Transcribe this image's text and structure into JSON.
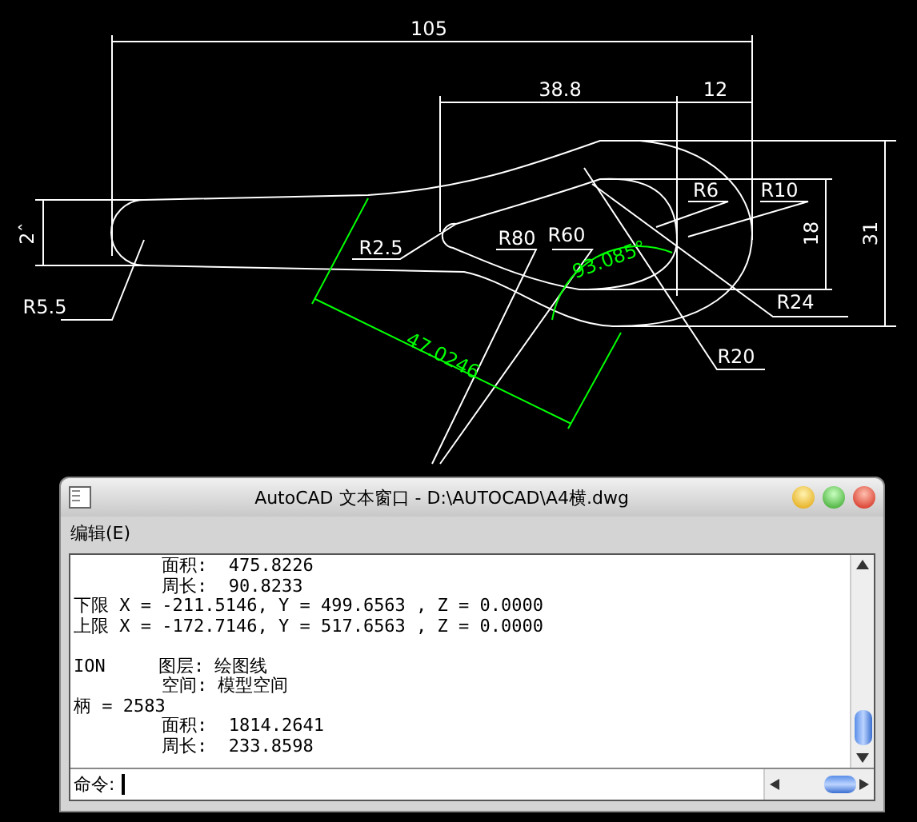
{
  "drawing": {
    "labels": [
      {
        "text": "105",
        "color": "#ffffff"
      },
      {
        "text": "38.8",
        "color": "#ffffff"
      },
      {
        "text": "12",
        "color": "#ffffff"
      },
      {
        "text": "R6",
        "color": "#ffffff"
      },
      {
        "text": "R10",
        "color": "#ffffff"
      },
      {
        "text": "2ˆ",
        "color": "#ffffff"
      },
      {
        "text": "R2.5",
        "color": "#ffffff"
      },
      {
        "text": "R80",
        "color": "#ffffff"
      },
      {
        "text": "R60",
        "color": "#ffffff"
      },
      {
        "text": "93.085°",
        "color": "#00ff00"
      },
      {
        "text": "18",
        "color": "#ffffff"
      },
      {
        "text": "31",
        "color": "#ffffff"
      },
      {
        "text": "R5.5",
        "color": "#ffffff"
      },
      {
        "text": "R24",
        "color": "#ffffff"
      },
      {
        "text": "47.0246",
        "color": "#00ff00"
      },
      {
        "text": "R20",
        "color": "#ffffff"
      }
    ]
  },
  "text_window": {
    "title": "AutoCAD 文本窗口 - D:\\AUTOCAD\\A4横.dwg",
    "menu": [
      "编辑(E)"
    ],
    "lines": [
      {
        "text": "面积:  475.8226",
        "indent": true,
        "gap_before": false
      },
      {
        "text": "周长:  90.8233",
        "indent": true,
        "gap_before": false
      },
      {
        "text": "下限 X = -211.5146, Y = 499.6563 , Z = 0.0000",
        "indent": false,
        "gap_before": false
      },
      {
        "text": "上限 X = -172.7146, Y = 517.6563 , Z = 0.0000",
        "indent": false,
        "gap_before": false
      },
      {
        "text": "ION     图层: 绘图线",
        "indent": false,
        "gap_before": true
      },
      {
        "text": "空间: 模型空间",
        "indent": true,
        "gap_before": false
      },
      {
        "text": "柄 = 2583",
        "indent": false,
        "gap_before": false
      },
      {
        "text": "面积:  1814.2641",
        "indent": true,
        "gap_before": false
      },
      {
        "text": "周长:  233.8598",
        "indent": true,
        "gap_before": false
      }
    ],
    "command_prompt": "命令:"
  }
}
